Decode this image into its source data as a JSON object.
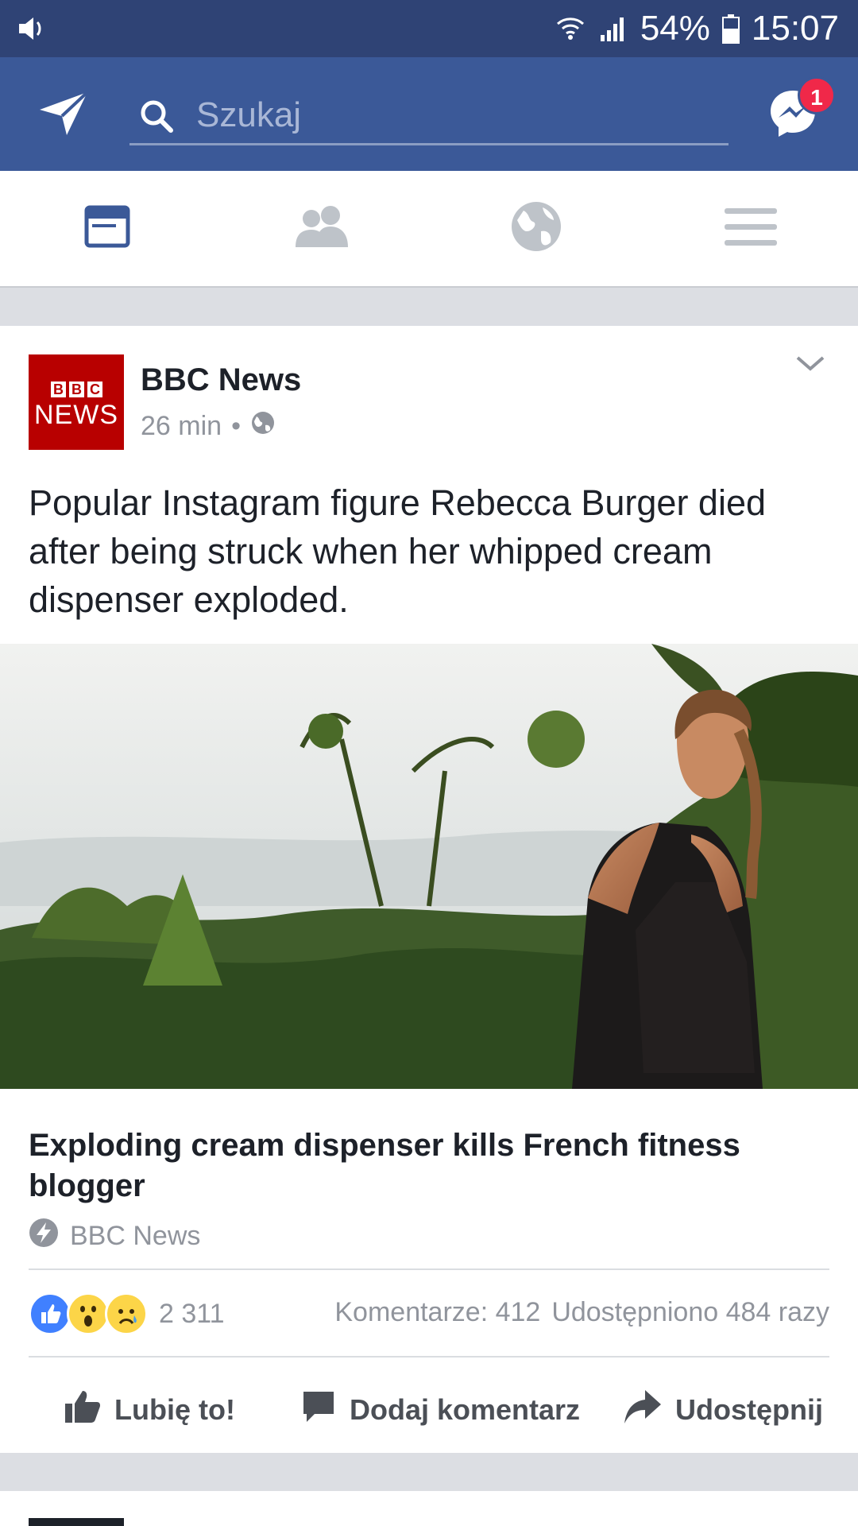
{
  "status_bar": {
    "battery": "54%",
    "time": "15:07"
  },
  "search": {
    "placeholder": "Szukaj"
  },
  "messenger": {
    "badge": "1"
  },
  "tabs": [
    {
      "name": "news-feed",
      "icon": "news-feed-icon",
      "active": true
    },
    {
      "name": "friends",
      "icon": "friends-icon",
      "active": false
    },
    {
      "name": "notifications",
      "icon": "globe-icon",
      "active": false
    },
    {
      "name": "menu",
      "icon": "menu-icon",
      "active": false
    }
  ],
  "post": {
    "avatar": {
      "line1": [
        "B",
        "B",
        "C"
      ],
      "line2": "NEWS"
    },
    "page_name": "BBC News",
    "time": "26 min",
    "dot": "•",
    "text": "Popular Instagram figure Rebecca Burger died after being struck when her whipped cream dispenser exploded.",
    "link_title": "Exploding cream dispenser kills French fitness blogger",
    "link_source": "BBC News",
    "reaction_count": "2 311",
    "comments": "Komentarze: 412",
    "shares": "Udostępniono 484 razy",
    "actions": {
      "like": "Lubię to!",
      "comment": "Dodaj komentarz",
      "share": "Udostępnij"
    }
  },
  "colors": {
    "brand": "#3b5998",
    "status_bar": "#2f4375",
    "active_tab": "#3b5998",
    "badge": "#f02849"
  }
}
